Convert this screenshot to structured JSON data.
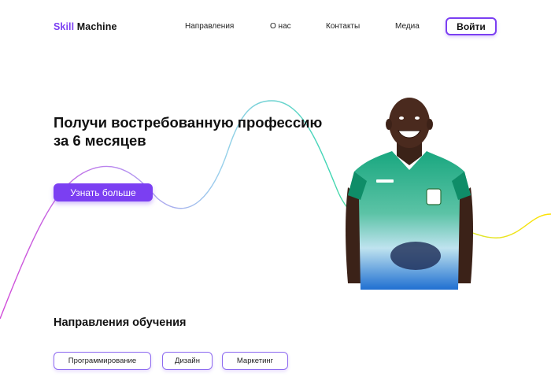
{
  "header": {
    "logo_accent": "Skill",
    "logo_rest": " Machine",
    "nav": [
      "Направления",
      "О нас",
      "Контакты",
      "Медиа"
    ],
    "login_label": "Войти"
  },
  "hero": {
    "title_line1": "Получи востребованную профессию",
    "title_line2": "за 6 месяцев",
    "cta_label": "Узнать больше"
  },
  "directions": {
    "title": "Направления обучения",
    "chips": [
      "Программирование",
      "Дизайн",
      "Маркетинг"
    ]
  },
  "colors": {
    "accent": "#7b3ff2",
    "curve_start": "#d14ad8",
    "curve_mid": "#3fd6b4",
    "curve_end": "#ffe100"
  }
}
